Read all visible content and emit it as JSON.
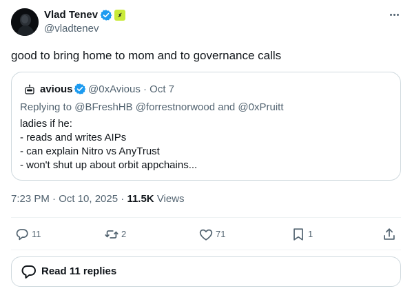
{
  "post": {
    "author_name": "Vlad Tenev",
    "author_handle": "@vladtenev",
    "text": "good to bring home to mom and to governance calls",
    "timestamp": "7:23 PM · Oct 10, 2025",
    "views_count": "11.5K",
    "views_label": "Views"
  },
  "quote": {
    "author_name": "avious",
    "author_handle": "@0xAvious",
    "date": "· Oct 7",
    "replying_to": "Replying to @BFreshHB @forrestnorwood and @0xPruitt",
    "lines": [
      "ladies if he:",
      "- reads and writes AIPs",
      "- can explain Nitro vs AnyTrust",
      "- won't shut up about orbit appchains..."
    ]
  },
  "actions": {
    "replies": "11",
    "reposts": "2",
    "likes": "71",
    "bookmarks": "1"
  },
  "read_replies_label": "Read 11 replies",
  "icons": [
    "verified-badge-icon",
    "affiliation-badge-icon",
    "more-icon",
    "reply-icon",
    "repost-icon",
    "like-icon",
    "bookmark-icon",
    "share-icon",
    "replies-bubble-icon"
  ],
  "colors": {
    "text": "#0f1419",
    "secondary": "#536471",
    "verified": "#1d9bf0",
    "affiliation": "#c9ea3a",
    "border": "#cfd9de",
    "divider": "#eff3f4"
  }
}
